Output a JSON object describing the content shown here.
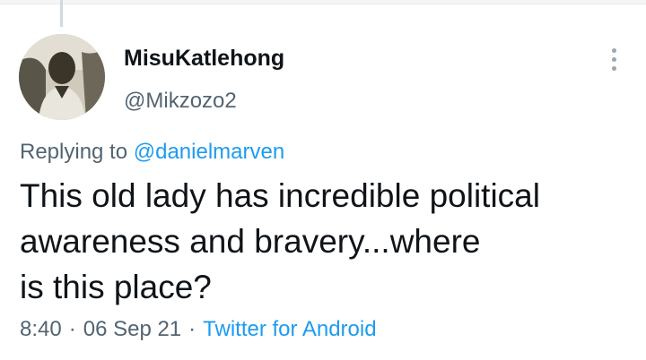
{
  "tweet": {
    "author_name": "MisuKatlehong",
    "author_handle": "@Mikzozo2",
    "replying_prefix": "Replying to",
    "replying_to": "@danielmarven",
    "text_lines": [
      "This old lady has incredible political",
      "awareness and bravery...where",
      "is this place?"
    ],
    "time": "8:40",
    "separator": "·",
    "date": "06 Sep 21",
    "source": "Twitter for Android"
  },
  "icons": {
    "more": "more-vertical-icon",
    "avatar": "user-photo"
  },
  "colors": {
    "link": "#1d9bf0",
    "secondary_text": "#536471",
    "primary_text": "#0f1419"
  }
}
